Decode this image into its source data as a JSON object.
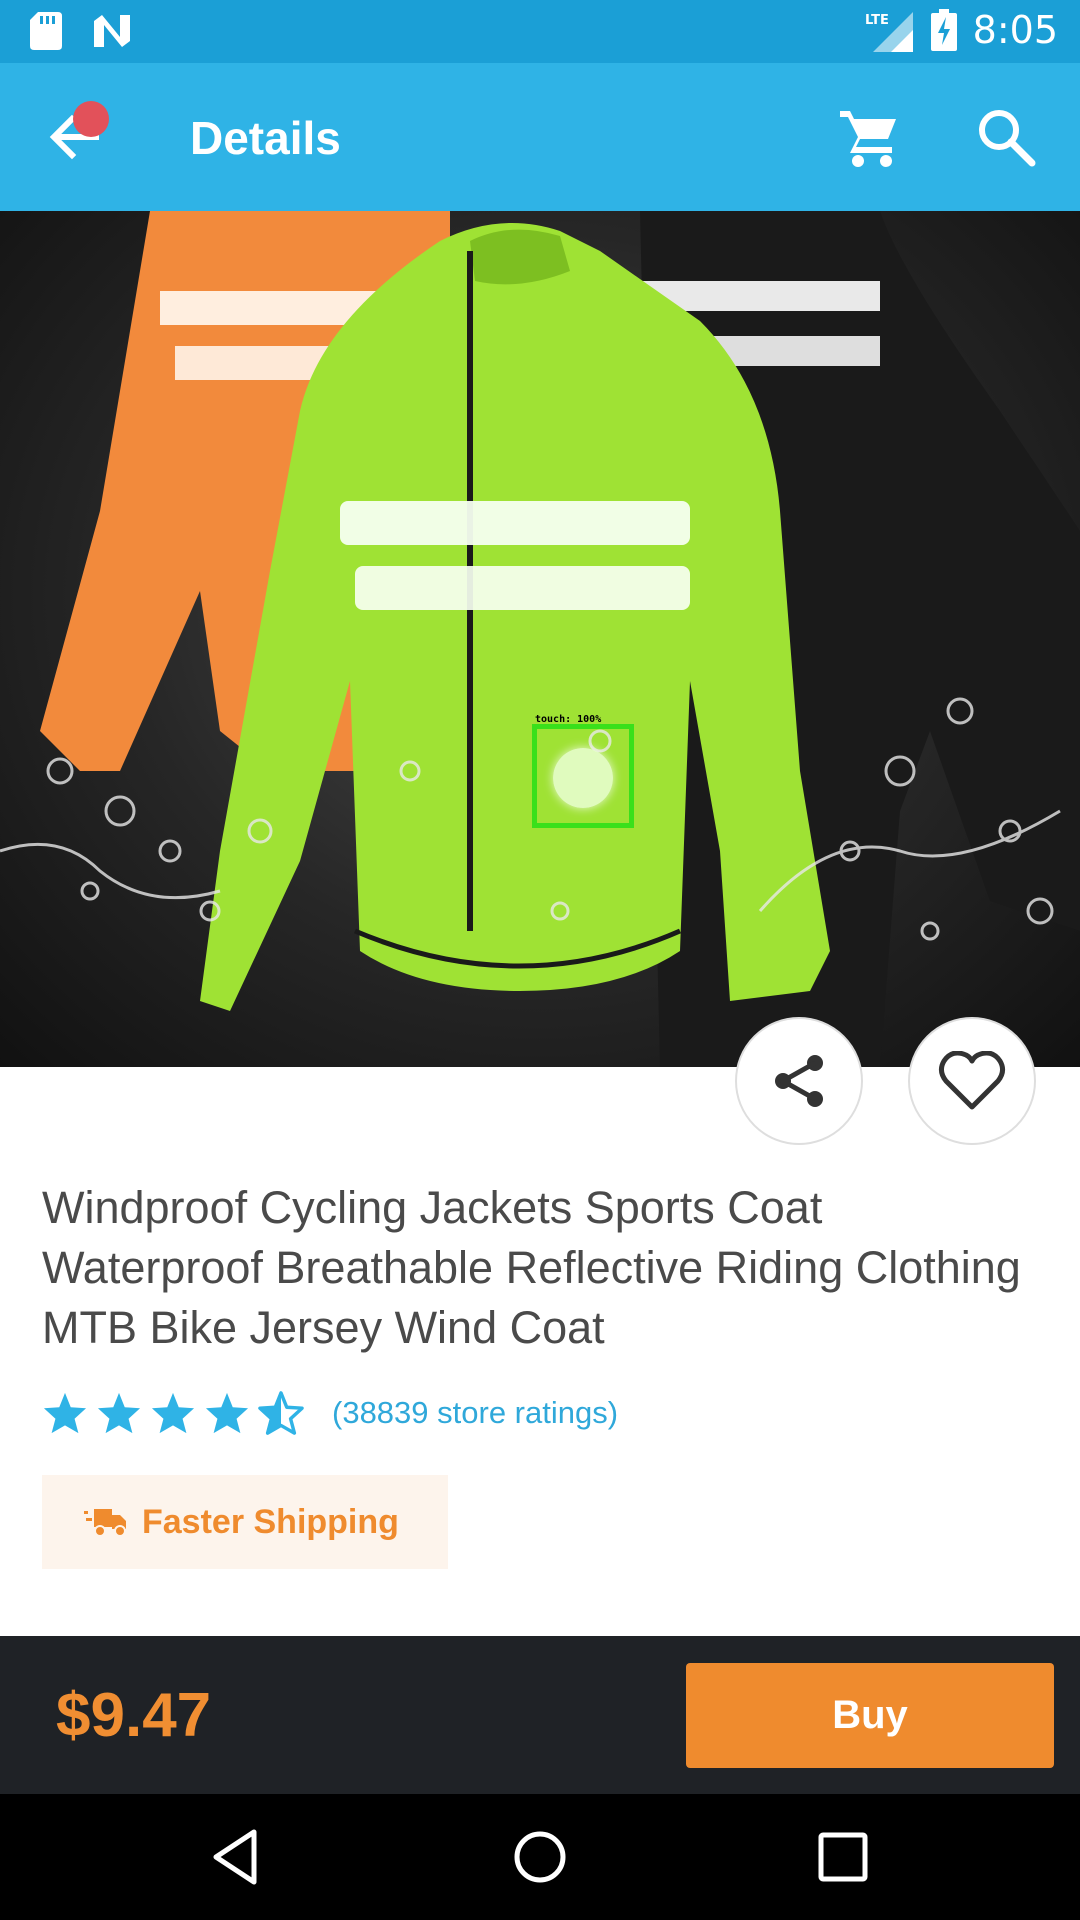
{
  "status_bar": {
    "time": "8:05",
    "network_label": "LTE",
    "icons": [
      "sd-card-icon",
      "n-notification-icon",
      "lte-signal-icon",
      "battery-charging-icon"
    ]
  },
  "app_bar": {
    "title": "Details",
    "back_icon": "arrow-back-icon",
    "cart_icon": "shopping-cart-icon",
    "search_icon": "search-icon",
    "background": "#2fb3e6",
    "status_background": "#1b9fd6"
  },
  "product_image": {
    "overlay_label": "touch: 100%",
    "overlay_color": "#39e01b"
  },
  "actions": {
    "share_icon": "share-icon",
    "favorite_icon": "heart-outline-icon"
  },
  "product": {
    "title": "Windproof Cycling Jackets Sports Coat Waterproof Breathable Reflective Riding Clothing MTB Bike Jersey Wind Coat",
    "rating": 4.5,
    "rating_text": "(38839 store ratings)",
    "shipping_label": "Faster Shipping",
    "shipping_icon": "delivery-truck-icon"
  },
  "buy_bar": {
    "price": "$9.47",
    "buy_label": "Buy",
    "accent": "#ef8b2e"
  },
  "nav_bar": {
    "icons": [
      "nav-back-icon",
      "nav-home-icon",
      "nav-recents-icon"
    ]
  }
}
